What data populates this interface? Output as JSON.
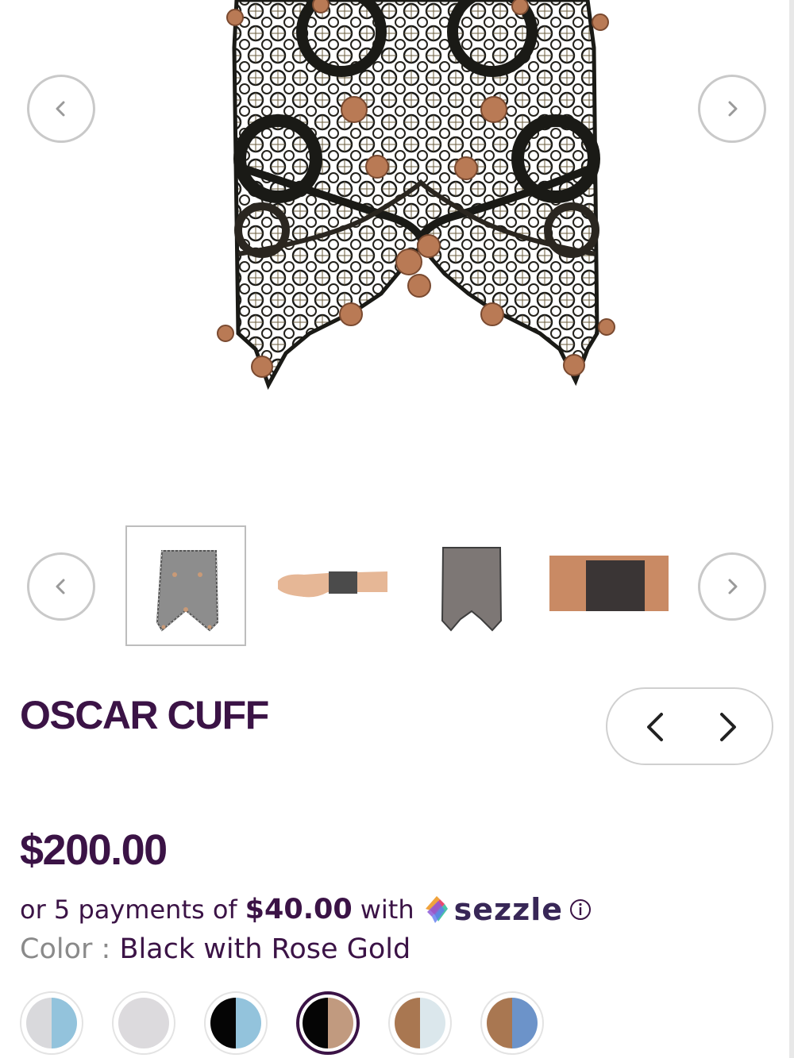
{
  "product": {
    "title": "OSCAR CUFF",
    "price": "$200.00"
  },
  "sezzle": {
    "prefix": "or 5 payments of",
    "amount": "$40.00",
    "with": "with",
    "brand": "sezzle"
  },
  "color": {
    "label": "Color :",
    "value": "Black with Rose Gold"
  },
  "swatches": [
    {
      "left": "#d9d9dc",
      "right": "#93c3dc"
    },
    {
      "left": "#dcdadd",
      "right": "#dcdadd"
    },
    {
      "left": "#050505",
      "right": "#93c3dc"
    },
    {
      "left": "#050505",
      "right": "#c19a7f"
    },
    {
      "left": "#a97751",
      "right": "#dbe7ec"
    },
    {
      "left": "#a97751",
      "right": "#6c93c9"
    }
  ],
  "selected_swatch_index": 3,
  "icons": {
    "gallery_prev": "chevron-left-icon",
    "gallery_next": "chevron-right-icon",
    "thumb_prev": "chevron-left-icon",
    "thumb_next": "chevron-right-icon",
    "info": "info-icon"
  },
  "colors": {
    "brand_purple": "#3b1346",
    "border_gray": "#c9c9c9"
  }
}
